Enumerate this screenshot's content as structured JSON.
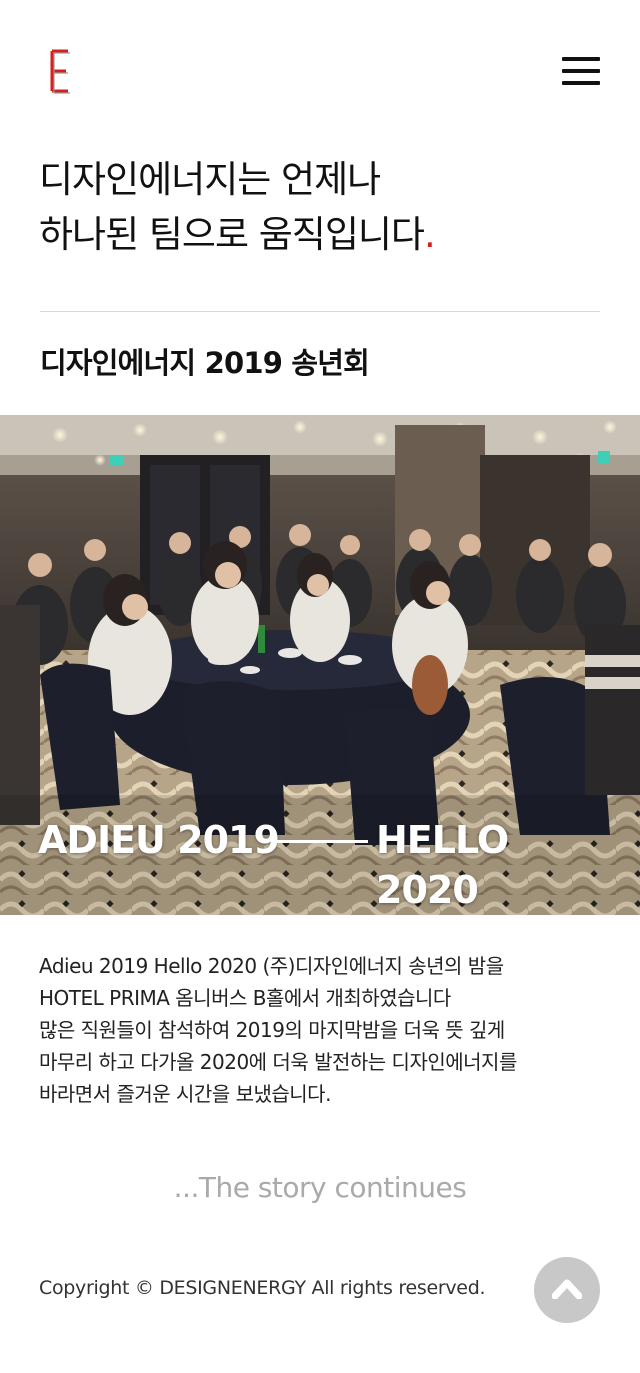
{
  "header": {
    "logo_icon": "letter-e-logo-icon",
    "menu_icon": "hamburger-menu-icon",
    "brand_color": "#d6201f"
  },
  "headline": {
    "line1": "디자인에너지는 언제나",
    "line2": "하나된 팀으로 움직입니다",
    "dot": "."
  },
  "post": {
    "title": "디자인에너지 2019 송년회"
  },
  "hero": {
    "image": "year-end-party-banquet-photo",
    "caption_left": "ADIEU 2019",
    "caption_right": "HELLO 2020"
  },
  "body": {
    "lines": [
      "Adieu 2019 Hello 2020 (주)디자인에너지 송년의 밤을",
      "HOTEL PRIMA 옴니버스 B홀에서 개최하였습니다",
      "많은 직원들이 참석하여 2019의 마지막밤을 더욱 뜻 깊게",
      "마무리 하고 다가올 2020에 더욱 발전하는 디자인에너지를",
      "바라면서 즐거운 시간을 보냈습니다."
    ]
  },
  "story": {
    "label": "...The story continues"
  },
  "footer": {
    "copyright": "Copyright © DESIGNENERGY All rights reserved.",
    "top_icon": "chevron-up-icon"
  }
}
